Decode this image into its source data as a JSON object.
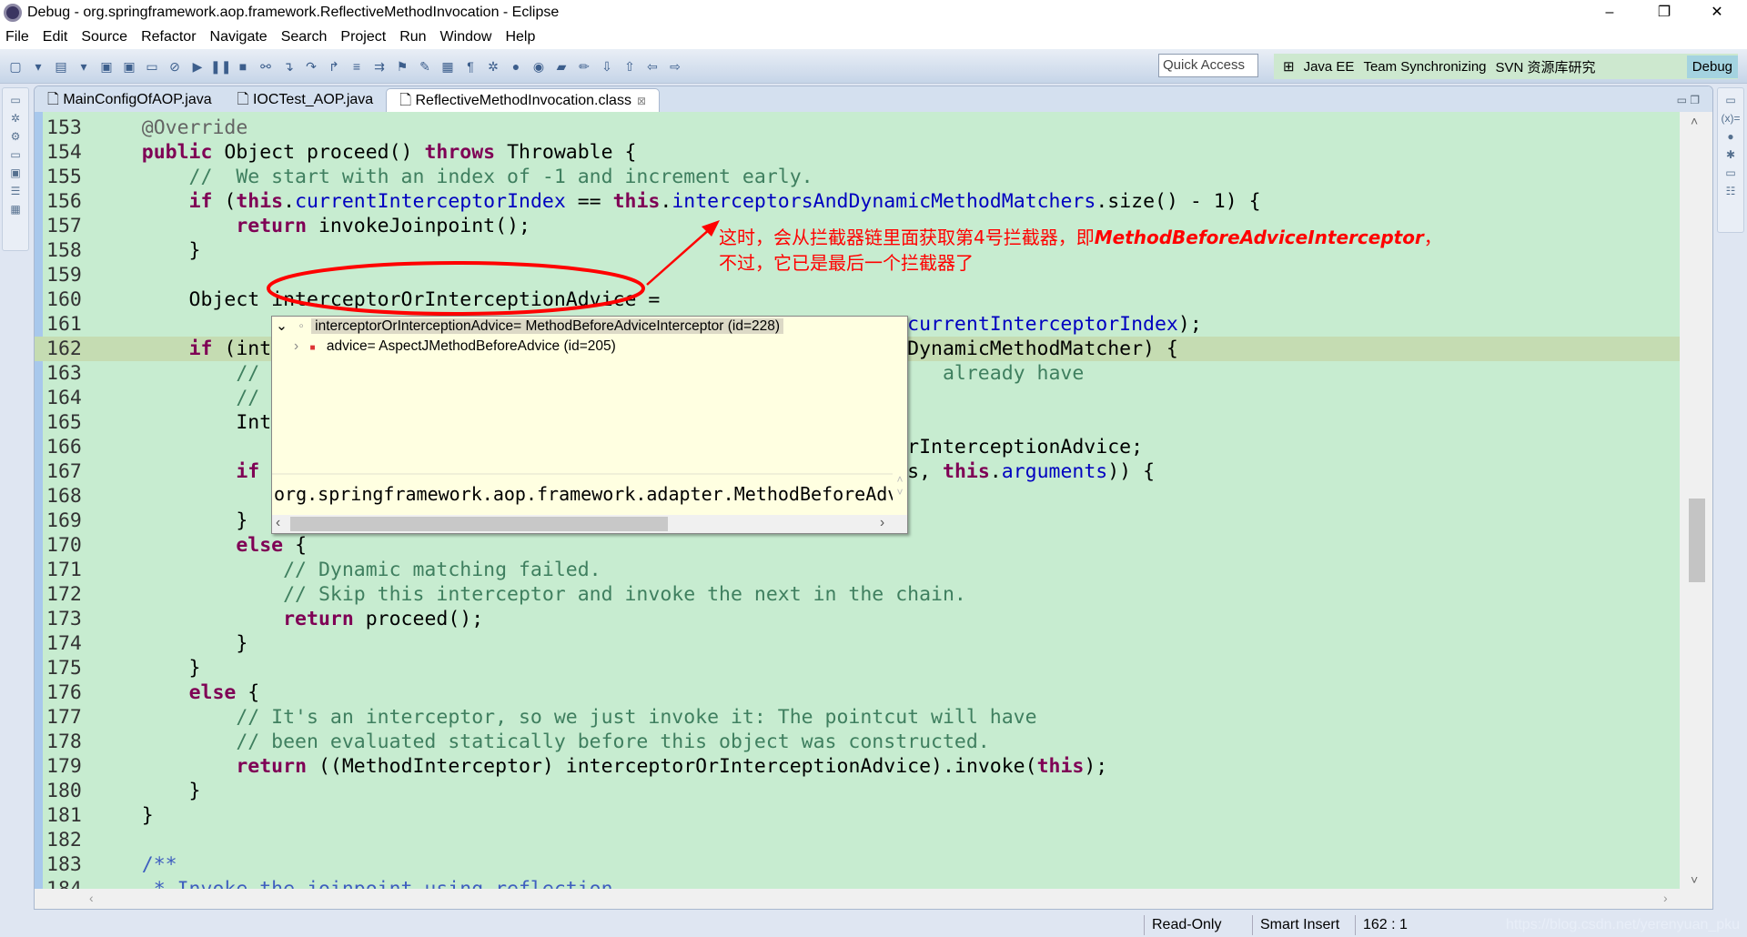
{
  "window": {
    "title": "Debug - org.springframework.aop.framework.ReflectiveMethodInvocation - Eclipse",
    "minimize": "–",
    "restore": "❐",
    "close": "✕"
  },
  "menu": [
    "File",
    "Edit",
    "Source",
    "Refactor",
    "Navigate",
    "Search",
    "Project",
    "Run",
    "Window",
    "Help"
  ],
  "toolbar": {
    "icons": [
      {
        "name": "new-icon",
        "glyph": "▢"
      },
      {
        "name": "new-dropdown-icon",
        "glyph": "▾"
      },
      {
        "name": "open-type-icon",
        "glyph": "▤"
      },
      {
        "name": "dropdown-icon",
        "glyph": "▾"
      },
      {
        "name": "save-icon",
        "glyph": "▣"
      },
      {
        "name": "save-all-icon",
        "glyph": "▣"
      },
      {
        "name": "console-icon",
        "glyph": "▭"
      },
      {
        "name": "skip-breakpoints-icon",
        "glyph": "⊘"
      },
      {
        "name": "resume-icon",
        "glyph": "▶"
      },
      {
        "name": "suspend-icon",
        "glyph": "❚❚"
      },
      {
        "name": "terminate-icon",
        "glyph": "■"
      },
      {
        "name": "disconnect-icon",
        "glyph": "⚯"
      },
      {
        "name": "step-into-icon",
        "glyph": "↴"
      },
      {
        "name": "step-over-icon",
        "glyph": "↷"
      },
      {
        "name": "step-return-icon",
        "glyph": "↱"
      },
      {
        "name": "drop-to-frame-icon",
        "glyph": "≡"
      },
      {
        "name": "use-step-filters-icon",
        "glyph": "⇉"
      },
      {
        "name": "toggle-breakpoint-icon",
        "glyph": "⚑"
      },
      {
        "name": "mark-occurrences-icon",
        "glyph": "✎"
      },
      {
        "name": "block-selection-icon",
        "glyph": "▦"
      },
      {
        "name": "show-whitespace-icon",
        "glyph": "¶"
      },
      {
        "name": "debug-icon",
        "glyph": "✲"
      },
      {
        "name": "run-icon",
        "glyph": "●"
      },
      {
        "name": "run-external-icon",
        "glyph": "◉"
      },
      {
        "name": "open-folder-icon",
        "glyph": "▰"
      },
      {
        "name": "pencil-icon",
        "glyph": "✏"
      },
      {
        "name": "next-annotation-icon",
        "glyph": "⇩"
      },
      {
        "name": "prev-annotation-icon",
        "glyph": "⇧"
      },
      {
        "name": "back-icon",
        "glyph": "⇦"
      },
      {
        "name": "forward-icon",
        "glyph": "⇨"
      }
    ]
  },
  "quick_access": {
    "placeholder": "Quick Access"
  },
  "perspectives": [
    {
      "label": "Java EE"
    },
    {
      "label": "Team Synchronizing"
    },
    {
      "label": "SVN 资源库研究"
    },
    {
      "label": "Debug",
      "active": true
    }
  ],
  "tabs": [
    {
      "label": "MainConfigOfAOP.java"
    },
    {
      "label": "IOCTest_AOP.java"
    },
    {
      "label": "ReflectiveMethodInvocation.class",
      "active": true,
      "close": "⊠"
    }
  ],
  "code": {
    "current_line": 162,
    "lines": [
      {
        "n": "153",
        "segs": [
          [
            "an",
            "    @Override"
          ]
        ]
      },
      {
        "n": "154",
        "segs": [
          [
            "",
            "    "
          ],
          [
            "kw",
            "public"
          ],
          [
            "",
            " Object proceed() "
          ],
          [
            "kw",
            "throws"
          ],
          [
            "",
            " Throwable {"
          ]
        ]
      },
      {
        "n": "155",
        "segs": [
          [
            "cm",
            "        //  We start with an index of -1 and increment early."
          ]
        ]
      },
      {
        "n": "156",
        "segs": [
          [
            "",
            "        "
          ],
          [
            "kw",
            "if"
          ],
          [
            "",
            " ("
          ],
          [
            "kw",
            "this"
          ],
          [
            "",
            "."
          ],
          [
            "fd",
            "currentInterceptorIndex"
          ],
          [
            "",
            " == "
          ],
          [
            "kw",
            "this"
          ],
          [
            "",
            "."
          ],
          [
            "fd",
            "interceptorsAndDynamicMethodMatchers"
          ],
          [
            "",
            ".size() - 1) {"
          ]
        ]
      },
      {
        "n": "157",
        "segs": [
          [
            "",
            "            "
          ],
          [
            "kw",
            "return"
          ],
          [
            "",
            " invokeJoinpoint();"
          ]
        ]
      },
      {
        "n": "158",
        "segs": [
          [
            "",
            "        }"
          ]
        ]
      },
      {
        "n": "159",
        "segs": []
      },
      {
        "n": "160",
        "segs": [
          [
            "",
            "        Object interceptorOrInterceptionAdvice ="
          ]
        ]
      },
      {
        "n": "161",
        "segs": [
          [
            "",
            "                                                                     "
          ],
          [
            "fd",
            "currentInterceptorIndex"
          ],
          [
            "",
            ");"
          ]
        ]
      },
      {
        "n": "162",
        "segs": [
          [
            "",
            "        "
          ],
          [
            "kw",
            "if"
          ],
          [
            "",
            " (int                                                      DynamicMethodMatcher) {"
          ]
        ]
      },
      {
        "n": "163",
        "segs": [
          [
            "cm",
            "            //                                                          already have"
          ]
        ]
      },
      {
        "n": "164",
        "segs": [
          [
            "cm",
            "            //"
          ]
        ]
      },
      {
        "n": "165",
        "segs": [
          [
            "",
            "            Int"
          ]
        ]
      },
      {
        "n": "166",
        "segs": [
          [
            "",
            "                                                                     rInterceptionAdvice;"
          ]
        ]
      },
      {
        "n": "167",
        "segs": [
          [
            "",
            "            "
          ],
          [
            "kw",
            "if"
          ],
          [
            "",
            "                                                       s, "
          ],
          [
            "kw",
            "this"
          ],
          [
            "",
            "."
          ],
          [
            "fd",
            "arguments"
          ],
          [
            "",
            ")) {"
          ]
        ]
      },
      {
        "n": "168",
        "segs": []
      },
      {
        "n": "169",
        "segs": [
          [
            "",
            "            }"
          ]
        ]
      },
      {
        "n": "170",
        "segs": [
          [
            "",
            "            "
          ],
          [
            "kw",
            "else"
          ],
          [
            "",
            " {"
          ]
        ]
      },
      {
        "n": "171",
        "segs": [
          [
            "cm",
            "                // Dynamic matching failed."
          ]
        ]
      },
      {
        "n": "172",
        "segs": [
          [
            "cm",
            "                // Skip this interceptor and invoke the next in the chain."
          ]
        ]
      },
      {
        "n": "173",
        "segs": [
          [
            "",
            "                "
          ],
          [
            "kw",
            "return"
          ],
          [
            "",
            " proceed();"
          ]
        ]
      },
      {
        "n": "174",
        "segs": [
          [
            "",
            "            }"
          ]
        ]
      },
      {
        "n": "175",
        "segs": [
          [
            "",
            "        }"
          ]
        ]
      },
      {
        "n": "176",
        "segs": [
          [
            "",
            "        "
          ],
          [
            "kw",
            "else"
          ],
          [
            "",
            " {"
          ]
        ]
      },
      {
        "n": "177",
        "segs": [
          [
            "cm",
            "            // It's an interceptor, so we just invoke it: The pointcut will have"
          ]
        ]
      },
      {
        "n": "178",
        "segs": [
          [
            "cm",
            "            // been evaluated statically before this object was constructed."
          ]
        ]
      },
      {
        "n": "179",
        "segs": [
          [
            "",
            "            "
          ],
          [
            "kw",
            "return"
          ],
          [
            "",
            " ((MethodInterceptor) interceptorOrInterceptionAdvice).invoke("
          ],
          [
            "kw",
            "this"
          ],
          [
            "",
            ");"
          ]
        ]
      },
      {
        "n": "180",
        "segs": [
          [
            "",
            "        }"
          ]
        ]
      },
      {
        "n": "181",
        "segs": [
          [
            "",
            "    }"
          ]
        ]
      },
      {
        "n": "182",
        "segs": []
      },
      {
        "n": "183",
        "segs": [
          [
            "jd",
            "    /**"
          ]
        ]
      },
      {
        "n": "184",
        "segs": [
          [
            "jd",
            "     * Invoke the joinpoint using reflection."
          ]
        ]
      }
    ]
  },
  "hover": {
    "root": {
      "toggle": "⌄",
      "label": "interceptorOrInterceptionAdvice= MethodBeforeAdviceInterceptor  (id=228)"
    },
    "child": {
      "toggle": "›",
      "label": "advice= AspectJMethodBeforeAdvice  (id=205)"
    },
    "detail": "org.springframework.aop.framework.adapter.MethodBeforeAdviceInterceptor"
  },
  "annotation": {
    "line1_prefix": "这时，会从拦截器链里面获取第4号拦截器，即",
    "line1_em": "MethodBeforeAdviceInterceptor",
    "line1_suffix": "，",
    "line2": "不过，它已是最后一个拦截器了",
    "color": "#ff0000"
  },
  "status": {
    "mode": "Read-Only",
    "insert": "Smart Insert",
    "position": "162 : 1",
    "watermark": "https://blog.csdn.net/yerenyuan_pku"
  },
  "colors": {
    "editor_bg": "#c7ecd0",
    "keyword": "#7f0055",
    "comment": "#3f7f5f",
    "field": "#0000c0"
  }
}
